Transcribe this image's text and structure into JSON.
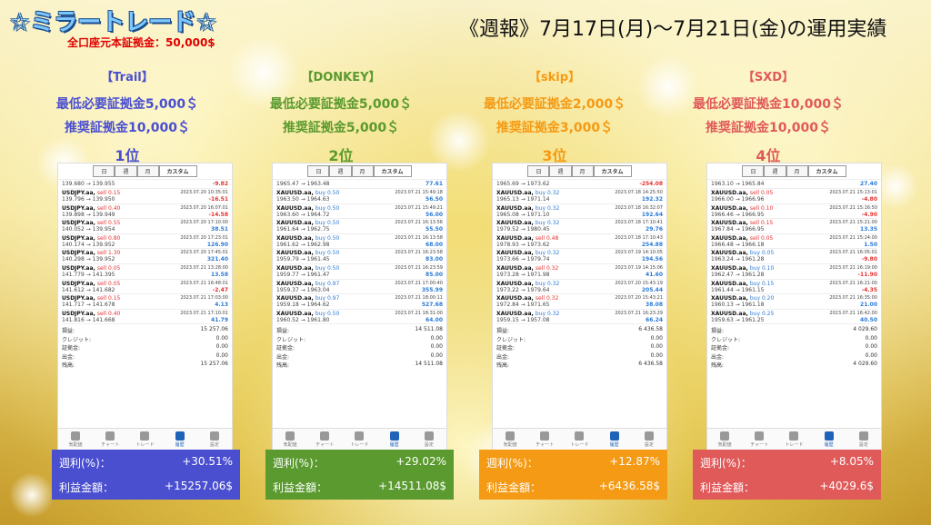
{
  "header": {
    "brand": "☆ミラートレード☆",
    "deposit": "全口座元本証拠金：50,000$",
    "report": "《週報》7月17日(月)〜7月21日(金)の運用実績"
  },
  "colors": {
    "trail": "#4a4fd0",
    "donkey": "#5a9a2e",
    "skip": "#f59a14",
    "sxd": "#e05a5a"
  },
  "columns": [
    {
      "name": "【Trail】",
      "min": "最低必要証拠金5,000＄",
      "rec": "推奨証拠金10,000＄",
      "rank": "1位",
      "tabs": [
        "日",
        "週",
        "月",
        "カスタム"
      ],
      "first": {
        "px": "139.680 → 139.955",
        "pl": "-9.82"
      },
      "rows": [
        {
          "sym": "USDJPY.aa,",
          "side": "sell 0.15",
          "date": "2023.07.20 10:35:01",
          "px": "139.796 → 139.950",
          "pl": "-16.51"
        },
        {
          "sym": "USDJPY.aa,",
          "side": "sell 0.40",
          "date": "2023.07.20 16:07:01",
          "px": "139.898 → 139.949",
          "pl": "-14.58"
        },
        {
          "sym": "USDJPY.aa,",
          "side": "sell 0.55",
          "date": "2023.07.20 17:10:00",
          "px": "140.052 → 139.954",
          "pl": "38.51"
        },
        {
          "sym": "USDJPY.aa,",
          "side": "sell 0.80",
          "date": "2023.07.20 17:23:01",
          "px": "140.174 → 139.952",
          "pl": "126.90"
        },
        {
          "sym": "USDJPY.aa,",
          "side": "sell 1.30",
          "date": "2023.07.20 17:45:01",
          "px": "140.298 → 139.952",
          "pl": "321.40"
        },
        {
          "sym": "USDJPY.aa,",
          "side": "sell 0.05",
          "date": "2023.07.21 13:28:00",
          "px": "141.779 → 141.395",
          "pl": "13.58"
        },
        {
          "sym": "USDJPY.aa,",
          "side": "sell 0.05",
          "date": "2023.07.21 16:48:01",
          "px": "141.612 → 141.682",
          "pl": "-2.47"
        },
        {
          "sym": "USDJPY.aa,",
          "side": "sell 0.15",
          "date": "2023.07.21 17:03:00",
          "px": "141.717 → 141.678",
          "pl": "4.13"
        },
        {
          "sym": "USDJPY.aa,",
          "side": "sell 0.40",
          "date": "2023.07.21 17:10:01",
          "px": "141.816 → 141.668",
          "pl": "41.79"
        }
      ],
      "summary": [
        {
          "k": "損益:",
          "v": "15 257.06"
        },
        {
          "k": "クレジット:",
          "v": "0.00"
        },
        {
          "k": "証拠金:",
          "v": "0.00"
        },
        {
          "k": "出金:",
          "v": "0.00"
        },
        {
          "k": "残高:",
          "v": "15 257.06"
        }
      ],
      "box": {
        "l1": "週利(%)：",
        "v1": "+30.51%",
        "l2": "利益金額：",
        "v2": "+15257.06$"
      }
    },
    {
      "name": "【DONKEY】",
      "min": "最低必要証拠金5,000＄",
      "rec": "推奨証拠金5,000＄",
      "rank": "2位",
      "tabs": [
        "日",
        "週",
        "月",
        "カスタム"
      ],
      "first": {
        "px": "1965.47 → 1963.48",
        "pl": "77.61"
      },
      "rows": [
        {
          "sym": "XAUUSD.aa,",
          "side": "buy 0.50",
          "date": "2023.07.21 15:49:18",
          "px": "1963.50 → 1964.63",
          "pl": "56.50"
        },
        {
          "sym": "XAUUSD.aa,",
          "side": "buy 0.50",
          "date": "2023.07.21 15:49:21",
          "px": "1963.60 → 1964.72",
          "pl": "56.00"
        },
        {
          "sym": "XAUUSD.aa,",
          "side": "buy 0.50",
          "date": "2023.07.21 16:13:56",
          "px": "1961.64 → 1962.75",
          "pl": "55.50"
        },
        {
          "sym": "XAUUSD.aa,",
          "side": "buy 0.50",
          "date": "2023.07.21 16:13:58",
          "px": "1961.62 → 1962.98",
          "pl": "68.00"
        },
        {
          "sym": "XAUUSD.aa,",
          "side": "buy 0.50",
          "date": "2023.07.21 16:23:58",
          "px": "1959.79 → 1961.45",
          "pl": "83.00"
        },
        {
          "sym": "XAUUSD.aa,",
          "side": "buy 0.50",
          "date": "2023.07.21 16:23:59",
          "px": "1959.77 → 1961.47",
          "pl": "85.00"
        },
        {
          "sym": "XAUUSD.aa,",
          "side": "buy 0.97",
          "date": "2023.07.21 17:00:40",
          "px": "1959.37 → 1963.04",
          "pl": "355.99"
        },
        {
          "sym": "XAUUSD.aa,",
          "side": "buy 0.97",
          "date": "2023.07.21 18:00:11",
          "px": "1959.18 → 1964.62",
          "pl": "527.68"
        },
        {
          "sym": "XAUUSD.aa,",
          "side": "buy 0.50",
          "date": "2023.07.21 18:31:00",
          "px": "1960.52 → 1961.80",
          "pl": "64.00"
        }
      ],
      "summary": [
        {
          "k": "損益:",
          "v": "14 511.08"
        },
        {
          "k": "クレジット:",
          "v": "0.00"
        },
        {
          "k": "証拠金:",
          "v": "0.00"
        },
        {
          "k": "出金:",
          "v": "0.00"
        },
        {
          "k": "残高:",
          "v": "14 511.08"
        }
      ],
      "box": {
        "l1": "週利(%)：",
        "v1": "+29.02%",
        "l2": "利益金額：",
        "v2": "+14511.08$"
      }
    },
    {
      "name": "【skip】",
      "min": "最低必要証拠金2,000＄",
      "rec": "推奨証拠金3,000＄",
      "rank": "3位",
      "tabs": [
        "日",
        "週",
        "月",
        "カスタム"
      ],
      "first": {
        "px": "1965.69 → 1973.62",
        "pl": "-254.08"
      },
      "rows": [
        {
          "sym": "XAUUSD.aa,",
          "side": "buy 0.32",
          "date": "2023.07.18 14:25:50",
          "px": "1965.13 → 1971.14",
          "pl": "192.32"
        },
        {
          "sym": "XAUUSD.aa,",
          "side": "buy 0.32",
          "date": "2023.07.18 16:32:07",
          "px": "1965.08 → 1971.10",
          "pl": "192.64"
        },
        {
          "sym": "XAUUSD.aa,",
          "side": "buy 0.32",
          "date": "2023.07.18 17:10:41",
          "px": "1979.52 → 1980.45",
          "pl": "29.76"
        },
        {
          "sym": "XAUUSD.aa,",
          "side": "sell 0.48",
          "date": "2023.07.18 17:10:43",
          "px": "1978.93 → 1973.62",
          "pl": "254.88"
        },
        {
          "sym": "XAUUSD.aa,",
          "side": "buy 0.32",
          "date": "2023.07.19 14:10:05",
          "px": "1973.66 → 1979.74",
          "pl": "194.56"
        },
        {
          "sym": "XAUUSD.aa,",
          "side": "sell 0.32",
          "date": "2023.07.19 14:15:06",
          "px": "1973.28 → 1971.98",
          "pl": "41.60"
        },
        {
          "sym": "XAUUSD.aa,",
          "side": "buy 0.32",
          "date": "2023.07.20 15:43:19",
          "px": "1973.22 → 1979.64",
          "pl": "205.44"
        },
        {
          "sym": "XAUUSD.aa,",
          "side": "sell 0.32",
          "date": "2023.07.20 15:43:21",
          "px": "1972.84 → 1971.65",
          "pl": "38.08"
        },
        {
          "sym": "XAUUSD.aa,",
          "side": "buy 0.32",
          "date": "2023.07.21 16:23:29",
          "px": "1959.15 → 1957.08",
          "pl": "66.24"
        }
      ],
      "summary": [
        {
          "k": "損益:",
          "v": "6 436.58"
        },
        {
          "k": "クレジット:",
          "v": "0.00"
        },
        {
          "k": "証拠金:",
          "v": "0.00"
        },
        {
          "k": "出金:",
          "v": "0.00"
        },
        {
          "k": "残高:",
          "v": "6 436.58"
        }
      ],
      "box": {
        "l1": "週利(%)：",
        "v1": "+12.87%",
        "l2": "利益金額：",
        "v2": "+6436.58$"
      }
    },
    {
      "name": "【SXD】",
      "min": "最低必要証拠金10,000＄",
      "rec": "推奨証拠金10,000＄",
      "rank": "4位",
      "tabs": [
        "日",
        "週",
        "月",
        "カスタム"
      ],
      "first": {
        "px": "1963.10 → 1965.84",
        "pl": "27.40"
      },
      "rows": [
        {
          "sym": "XAUUSD.aa,",
          "side": "sell 0.05",
          "date": "2023.07.21 15:13:01",
          "px": "1966.00 → 1966.96",
          "pl": "-4.80"
        },
        {
          "sym": "XAUUSD.aa,",
          "side": "sell 0.10",
          "date": "2023.07.21 15:16:50",
          "px": "1966.46 → 1966.95",
          "pl": "-4.90"
        },
        {
          "sym": "XAUUSD.aa,",
          "side": "sell 0.15",
          "date": "2023.07.21 15:21:00",
          "px": "1967.84 → 1966.95",
          "pl": "13.35"
        },
        {
          "sym": "XAUUSD.aa,",
          "side": "sell 0.05",
          "date": "2023.07.21 15:24:00",
          "px": "1966.48 → 1966.18",
          "pl": "1.50"
        },
        {
          "sym": "XAUUSD.aa,",
          "side": "buy 0.05",
          "date": "2023.07.21 16:05:01",
          "px": "1963.24 → 1961.28",
          "pl": "-9.80"
        },
        {
          "sym": "XAUUSD.aa,",
          "side": "buy 0.10",
          "date": "2023.07.21 16:19:00",
          "px": "1962.47 → 1961.28",
          "pl": "-11.90"
        },
        {
          "sym": "XAUUSD.aa,",
          "side": "buy 0.15",
          "date": "2023.07.21 16:21:00",
          "px": "1961.44 → 1961.15",
          "pl": "-4.35"
        },
        {
          "sym": "XAUUSD.aa,",
          "side": "buy 0.20",
          "date": "2023.07.21 16:35:00",
          "px": "1960.13 → 1961.18",
          "pl": "21.00"
        },
        {
          "sym": "XAUUSD.aa,",
          "side": "buy 0.25",
          "date": "2023.07.21 16:42:00",
          "px": "1959.63 → 1961.25",
          "pl": "40.50"
        }
      ],
      "summary": [
        {
          "k": "損益:",
          "v": "4 029.60"
        },
        {
          "k": "クレジット:",
          "v": "0.00"
        },
        {
          "k": "証拠金:",
          "v": "0.00"
        },
        {
          "k": "出金:",
          "v": "0.00"
        },
        {
          "k": "残高:",
          "v": "4 029.60"
        }
      ],
      "box": {
        "l1": "週利(%)：",
        "v1": "+8.05%",
        "l2": "利益金額：",
        "v2": "+4029.6$"
      }
    }
  ],
  "nav": [
    "気配値",
    "チャート",
    "トレード",
    "履歴",
    "設定"
  ]
}
